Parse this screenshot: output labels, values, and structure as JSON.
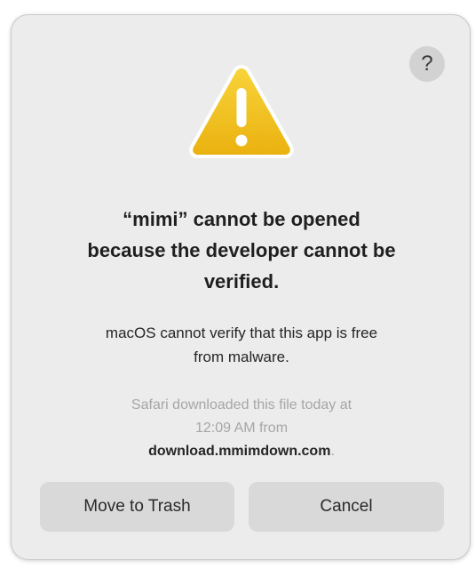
{
  "dialog": {
    "help_label": "?",
    "icon": "warning-triangle-icon",
    "title_lines": [
      "“mimi” cannot be opened",
      "because the developer cannot be",
      "verified."
    ],
    "message_lines": [
      "macOS cannot verify that this app is free",
      "from malware."
    ],
    "info_line1": "Safari downloaded this file today at",
    "info_line2": "12:09 AM from",
    "info_domain": "download.mmimdown.com",
    "info_period": ".",
    "buttons": {
      "trash": "Move to Trash",
      "cancel": "Cancel"
    }
  },
  "colors": {
    "dialog_background": "#ececec",
    "button_background": "#d9d9d9",
    "warning_yellow": "#f2c21b",
    "muted_text": "#a6a6a6"
  }
}
